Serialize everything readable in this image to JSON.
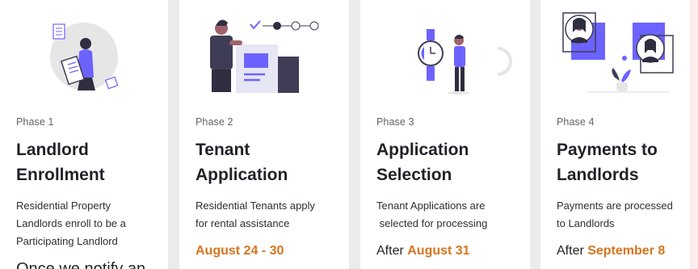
{
  "phases": [
    {
      "phase": "Phase 1",
      "title_line1": "Landlord",
      "title_line2": "Enrollment",
      "desc_lines": [
        "Residential Property",
        "Landlords enroll to be a",
        "Participating Landlord"
      ],
      "clipped_text": "Once we notify an"
    },
    {
      "phase": "Phase 2",
      "title_line1": "Tenant",
      "title_line2": "Application",
      "desc_lines": [
        "Residential Tenants apply",
        "for rental assistance"
      ],
      "date": "August 24 - 30"
    },
    {
      "phase": "Phase 3",
      "title_line1": "Application",
      "title_line2": "Selection",
      "desc_lines": [
        "Tenant Applications are",
        " selected for processing"
      ],
      "date_prefix": "After ",
      "date": "August 31"
    },
    {
      "phase": "Phase 4",
      "title_line1": "Payments to",
      "title_line2": "Landlords",
      "desc_lines": [
        "Payments are processed",
        "to Landlords"
      ],
      "date_prefix": "After ",
      "date": "September 8"
    }
  ],
  "colors": {
    "accent": "#d7741f",
    "illustration_purple": "#6c63ff",
    "background": "#ebebee"
  },
  "icons": [
    "document-woman-illustration",
    "progress-steps-illustration",
    "clock-man-illustration",
    "profiles-illustration"
  ]
}
